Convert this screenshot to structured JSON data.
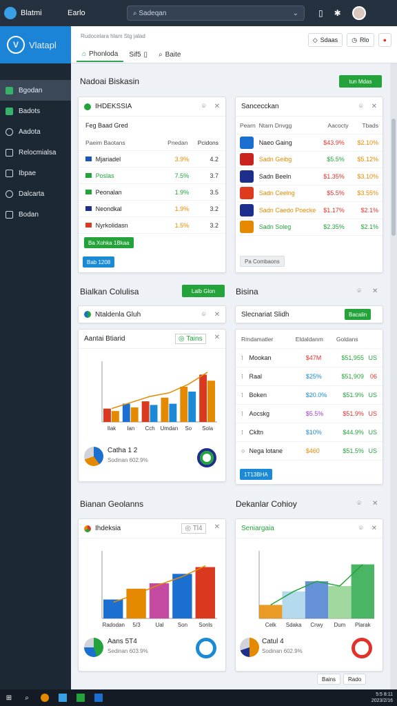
{
  "topbar": {
    "app_title": "Blatmi",
    "menu": "Earlo",
    "search_placeholder": "Sadeqan"
  },
  "sidebar": {
    "brand": "Vlatapl",
    "items": [
      {
        "label": "Bgodan"
      },
      {
        "label": "Badots"
      },
      {
        "label": "Aadota"
      },
      {
        "label": "Relocmialsa"
      },
      {
        "label": "Ibpae"
      },
      {
        "label": "Dalcarta"
      },
      {
        "label": "Bodan"
      }
    ]
  },
  "header": {
    "breadcrumb": "Rudocelara hlam Stg jalad",
    "tabs": [
      "Phonloda",
      "Sif5",
      "Baite"
    ],
    "btn1": "Sdaas",
    "btn2": "Rlo"
  },
  "section1": {
    "title": "Nadoai Biskasin",
    "action": "tun Mdas"
  },
  "card_a": {
    "title": "IHDEKSSIA",
    "subtitle": "Feg Baad Gred",
    "headers": [
      "Paeim Baotans",
      "Pnedan",
      "Pcidons"
    ],
    "rows": [
      {
        "name": "Mjariadel",
        "a": "3.9%",
        "b": "4.2",
        "color": "#1a56b8",
        "acolor": "#e58a00",
        "ncolor": "#222"
      },
      {
        "name": "Poslas",
        "a": "7.5%",
        "b": "3.7",
        "color": "#23a33c",
        "acolor": "#23a33c",
        "ncolor": "#23a33c"
      },
      {
        "name": "Peonalan",
        "a": "1.9%",
        "b": "3.5",
        "color": "#23a33c",
        "acolor": "#23a33c",
        "ncolor": "#222"
      },
      {
        "name": "Neondkal",
        "a": "1.9%",
        "b": "3.2",
        "color": "#1d2f8a",
        "acolor": "#e58a00",
        "ncolor": "#222"
      },
      {
        "name": "Nyrkolidasn",
        "a": "1.5%",
        "b": "3.2",
        "color": "#d9391f",
        "acolor": "#e58a00",
        "ncolor": "#222"
      }
    ],
    "btn_green": "Ba Xohka 1Bkaa",
    "btn_blue": "Bab 1208"
  },
  "card_b": {
    "title": "Sancecckan",
    "headers": [
      "Pearn",
      "Ntarn Dnvgg",
      "Aacocty",
      "Tbads"
    ],
    "rows": [
      {
        "name": "Naeo Gaing",
        "a": "$43.9%",
        "b": "$2.10%",
        "color": "#1a6fd0",
        "ncolor": "#222",
        "acolor": "#e0322b",
        "bcolor": "#e58a00"
      },
      {
        "name": "Sadn Geibg",
        "a": "$5.5%",
        "b": "$5.12%",
        "color": "#c8231e",
        "ncolor": "#e58a00",
        "acolor": "#23a33c",
        "bcolor": "#e58a00"
      },
      {
        "name": "Sadn Beeln",
        "a": "$1.35%",
        "b": "$3.10%",
        "color": "#1d2f8a",
        "ncolor": "#222",
        "acolor": "#e0322b",
        "bcolor": "#e58a00"
      },
      {
        "name": "Sadn Ceelng",
        "a": "$5.5%",
        "b": "$3.55%",
        "color": "#e03a1e",
        "ncolor": "#e58a00",
        "acolor": "#e0322b",
        "bcolor": "#e58a00"
      },
      {
        "name": "Sadn Caedo Poecke",
        "a": "$1.17%",
        "b": "$2.1%",
        "color": "#1d2f8a",
        "ncolor": "#e58a00",
        "acolor": "#e0322b",
        "bcolor": "#e0322b"
      },
      {
        "name": "Sadn Soleg",
        "a": "$2.35%",
        "b": "$2.1%",
        "color": "#e58a00",
        "ncolor": "#23a33c",
        "acolor": "#23a33c",
        "bcolor": "#23a33c"
      }
    ],
    "btn": "Pa Combaons"
  },
  "section2": {
    "title": "Bialkan Colulisa",
    "action": "Lalb Glon",
    "right_title": "Bisina"
  },
  "card_c": {
    "title": "Ntaldenla Gluh"
  },
  "card_d": {
    "title": "Slecnariat Slidh",
    "btn": "Bacalin"
  },
  "card_e": {
    "title": "Aantai Btiarid",
    "btn": "Tains",
    "legend_title": "Catha 1 2",
    "legend_sub": "Sodinan 602.9%"
  },
  "card_f": {
    "headers": [
      "Rmdamatler",
      "Eldaldanm",
      "Goldans"
    ],
    "rows": [
      {
        "name": "Mookan",
        "a": "$47M",
        "b": "$51,955",
        "c": "US",
        "acolor": "#e0322b",
        "bcolor": "#23a33c",
        "ccolor": "#23a33c"
      },
      {
        "name": "Raal",
        "a": "$25%",
        "b": "$51,909",
        "c": "06",
        "acolor": "#1a8ad6",
        "bcolor": "#23a33c",
        "ccolor": "#e0322b"
      },
      {
        "name": "Boken",
        "a": "$20.0%",
        "b": "$51.9%",
        "c": "US",
        "acolor": "#1a8ad6",
        "bcolor": "#23a33c",
        "ccolor": "#23a33c"
      },
      {
        "name": "Aocskg",
        "a": "$5.5%",
        "b": "$51.9%",
        "c": "US",
        "acolor": "#9a3bd0",
        "bcolor": "#e0322b",
        "ccolor": "#e0322b"
      },
      {
        "name": "Ckltn",
        "a": "$10%",
        "b": "$44.9%",
        "c": "US",
        "acolor": "#1a8ad6",
        "bcolor": "#23a33c",
        "ccolor": "#23a33c"
      },
      {
        "name": "Nega lotane",
        "a": "$460",
        "b": "$51.5%",
        "c": "US",
        "acolor": "#e58a00",
        "bcolor": "#23a33c",
        "ccolor": "#23a33c"
      }
    ],
    "btn": "1T13BHA"
  },
  "section3": {
    "title": "Bianan Geolanns",
    "right_title": "Dekanlar Cohioy"
  },
  "card_g": {
    "title": "Ihdeksia",
    "btn": "Tl4",
    "legend_title": "Aans 5T4",
    "legend_sub": "Sedinan 603.9%"
  },
  "card_h": {
    "title": "Seniargaia",
    "legend_title": "Catul 4",
    "legend_sub": "Sodinan 602.9%"
  },
  "bottom": {
    "btn1": "Bains",
    "btn2": "Rado"
  },
  "taskbar": {
    "time": "5:5 8:11",
    "date": "2023/2/16"
  },
  "chart_data": [
    {
      "type": "bar",
      "categories": [
        "Ilak",
        "Ian",
        "Cch",
        "Umdan",
        "So",
        "Sola"
      ],
      "series": [
        {
          "values": [
            22,
            30,
            34,
            40,
            58,
            78
          ],
          "color": "#e58a00"
        },
        {
          "values": [
            18,
            24,
            28,
            30,
            50,
            68
          ],
          "color": "#d9391f"
        }
      ],
      "line": [
        22,
        32,
        42,
        48,
        62,
        82
      ],
      "ylim": [
        0,
        100
      ]
    },
    {
      "type": "bar",
      "categories": [
        "Radodan",
        "5/3",
        "Ual",
        "Son",
        "Sonls"
      ],
      "series": [
        {
          "values": [
            28,
            44,
            52,
            66,
            76
          ],
          "color": "#1a6fd0"
        }
      ],
      "line": [
        24,
        36,
        50,
        62,
        78
      ],
      "ylim": [
        0,
        100
      ]
    },
    {
      "type": "area",
      "categories": [
        "Celk",
        "Sdaka",
        "Crwy",
        "Dum",
        "Plarak"
      ],
      "values": [
        20,
        40,
        55,
        48,
        80
      ],
      "ylim": [
        0,
        100
      ]
    }
  ]
}
